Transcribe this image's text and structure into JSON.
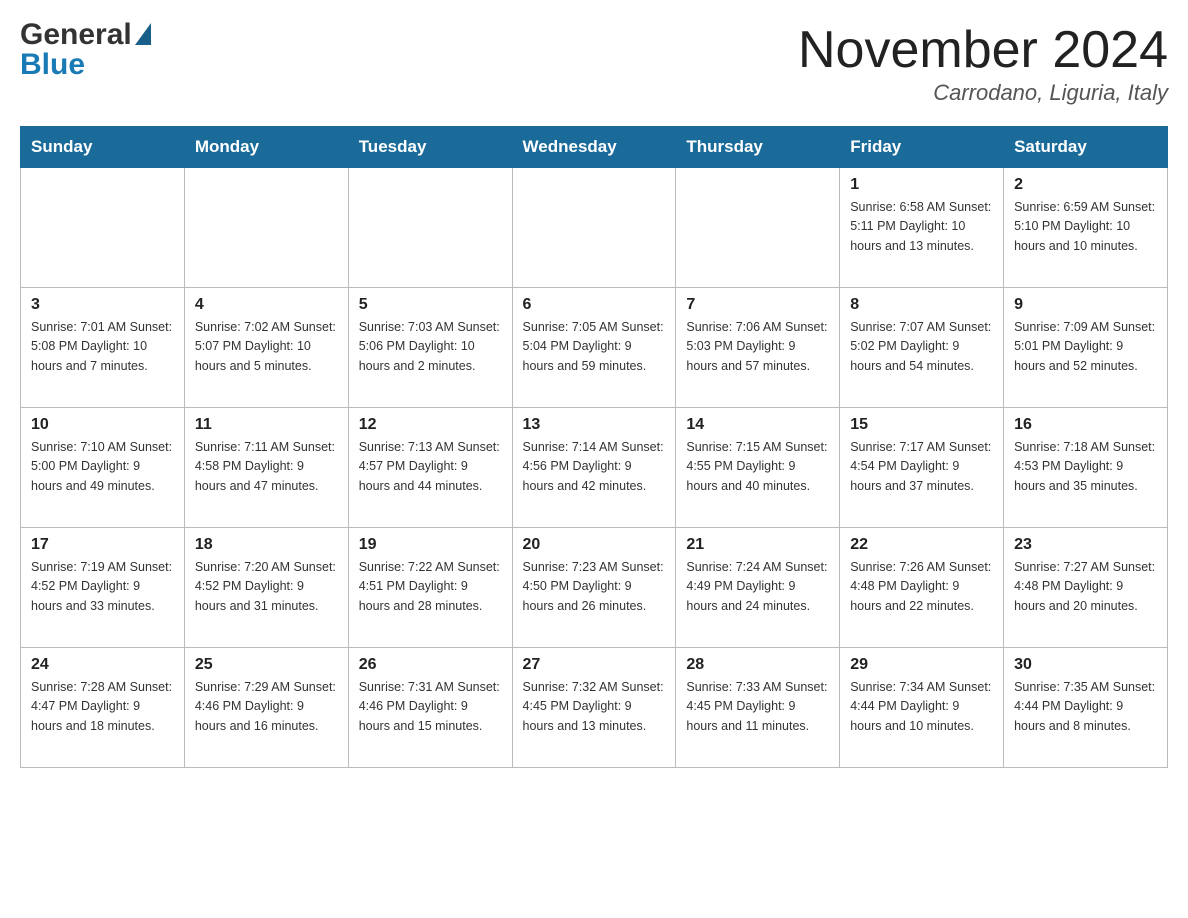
{
  "header": {
    "month_title": "November 2024",
    "location": "Carrodano, Liguria, Italy",
    "logo_general": "General",
    "logo_blue": "Blue"
  },
  "days_of_week": [
    "Sunday",
    "Monday",
    "Tuesday",
    "Wednesday",
    "Thursday",
    "Friday",
    "Saturday"
  ],
  "weeks": [
    {
      "days": [
        {
          "number": "",
          "info": ""
        },
        {
          "number": "",
          "info": ""
        },
        {
          "number": "",
          "info": ""
        },
        {
          "number": "",
          "info": ""
        },
        {
          "number": "",
          "info": ""
        },
        {
          "number": "1",
          "info": "Sunrise: 6:58 AM\nSunset: 5:11 PM\nDaylight: 10 hours\nand 13 minutes."
        },
        {
          "number": "2",
          "info": "Sunrise: 6:59 AM\nSunset: 5:10 PM\nDaylight: 10 hours\nand 10 minutes."
        }
      ]
    },
    {
      "days": [
        {
          "number": "3",
          "info": "Sunrise: 7:01 AM\nSunset: 5:08 PM\nDaylight: 10 hours\nand 7 minutes."
        },
        {
          "number": "4",
          "info": "Sunrise: 7:02 AM\nSunset: 5:07 PM\nDaylight: 10 hours\nand 5 minutes."
        },
        {
          "number": "5",
          "info": "Sunrise: 7:03 AM\nSunset: 5:06 PM\nDaylight: 10 hours\nand 2 minutes."
        },
        {
          "number": "6",
          "info": "Sunrise: 7:05 AM\nSunset: 5:04 PM\nDaylight: 9 hours\nand 59 minutes."
        },
        {
          "number": "7",
          "info": "Sunrise: 7:06 AM\nSunset: 5:03 PM\nDaylight: 9 hours\nand 57 minutes."
        },
        {
          "number": "8",
          "info": "Sunrise: 7:07 AM\nSunset: 5:02 PM\nDaylight: 9 hours\nand 54 minutes."
        },
        {
          "number": "9",
          "info": "Sunrise: 7:09 AM\nSunset: 5:01 PM\nDaylight: 9 hours\nand 52 minutes."
        }
      ]
    },
    {
      "days": [
        {
          "number": "10",
          "info": "Sunrise: 7:10 AM\nSunset: 5:00 PM\nDaylight: 9 hours\nand 49 minutes."
        },
        {
          "number": "11",
          "info": "Sunrise: 7:11 AM\nSunset: 4:58 PM\nDaylight: 9 hours\nand 47 minutes."
        },
        {
          "number": "12",
          "info": "Sunrise: 7:13 AM\nSunset: 4:57 PM\nDaylight: 9 hours\nand 44 minutes."
        },
        {
          "number": "13",
          "info": "Sunrise: 7:14 AM\nSunset: 4:56 PM\nDaylight: 9 hours\nand 42 minutes."
        },
        {
          "number": "14",
          "info": "Sunrise: 7:15 AM\nSunset: 4:55 PM\nDaylight: 9 hours\nand 40 minutes."
        },
        {
          "number": "15",
          "info": "Sunrise: 7:17 AM\nSunset: 4:54 PM\nDaylight: 9 hours\nand 37 minutes."
        },
        {
          "number": "16",
          "info": "Sunrise: 7:18 AM\nSunset: 4:53 PM\nDaylight: 9 hours\nand 35 minutes."
        }
      ]
    },
    {
      "days": [
        {
          "number": "17",
          "info": "Sunrise: 7:19 AM\nSunset: 4:52 PM\nDaylight: 9 hours\nand 33 minutes."
        },
        {
          "number": "18",
          "info": "Sunrise: 7:20 AM\nSunset: 4:52 PM\nDaylight: 9 hours\nand 31 minutes."
        },
        {
          "number": "19",
          "info": "Sunrise: 7:22 AM\nSunset: 4:51 PM\nDaylight: 9 hours\nand 28 minutes."
        },
        {
          "number": "20",
          "info": "Sunrise: 7:23 AM\nSunset: 4:50 PM\nDaylight: 9 hours\nand 26 minutes."
        },
        {
          "number": "21",
          "info": "Sunrise: 7:24 AM\nSunset: 4:49 PM\nDaylight: 9 hours\nand 24 minutes."
        },
        {
          "number": "22",
          "info": "Sunrise: 7:26 AM\nSunset: 4:48 PM\nDaylight: 9 hours\nand 22 minutes."
        },
        {
          "number": "23",
          "info": "Sunrise: 7:27 AM\nSunset: 4:48 PM\nDaylight: 9 hours\nand 20 minutes."
        }
      ]
    },
    {
      "days": [
        {
          "number": "24",
          "info": "Sunrise: 7:28 AM\nSunset: 4:47 PM\nDaylight: 9 hours\nand 18 minutes."
        },
        {
          "number": "25",
          "info": "Sunrise: 7:29 AM\nSunset: 4:46 PM\nDaylight: 9 hours\nand 16 minutes."
        },
        {
          "number": "26",
          "info": "Sunrise: 7:31 AM\nSunset: 4:46 PM\nDaylight: 9 hours\nand 15 minutes."
        },
        {
          "number": "27",
          "info": "Sunrise: 7:32 AM\nSunset: 4:45 PM\nDaylight: 9 hours\nand 13 minutes."
        },
        {
          "number": "28",
          "info": "Sunrise: 7:33 AM\nSunset: 4:45 PM\nDaylight: 9 hours\nand 11 minutes."
        },
        {
          "number": "29",
          "info": "Sunrise: 7:34 AM\nSunset: 4:44 PM\nDaylight: 9 hours\nand 10 minutes."
        },
        {
          "number": "30",
          "info": "Sunrise: 7:35 AM\nSunset: 4:44 PM\nDaylight: 9 hours\nand 8 minutes."
        }
      ]
    }
  ]
}
